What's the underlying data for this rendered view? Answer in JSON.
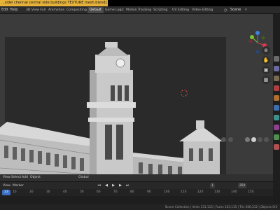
{
  "window": {
    "title": "...sidel chennai central side buildings TEXTURE mesh.blend]"
  },
  "menu": [
    "Edit",
    "Help"
  ],
  "workspace_tabs": [
    "3D View Full",
    "Animation",
    "Compositing",
    "Default",
    "Game Logic",
    "Motion Tracking",
    "Scripting",
    "UV Editing",
    "Video Editing"
  ],
  "active_tab_index": 3,
  "scene": {
    "label": "Scene"
  },
  "viewport_header": {
    "items": [
      "View",
      "Select",
      "Add",
      "Object"
    ],
    "mode": "Global"
  },
  "timeline": {
    "items": [
      "View",
      "Marker"
    ],
    "ruler_ticks": [
      "23",
      "10",
      "20",
      "30",
      "40",
      "50",
      "60",
      "70",
      "80",
      "90",
      "100",
      "110",
      "120",
      "130",
      "140",
      "150"
    ],
    "start_frame": "1",
    "end_frame": "250"
  },
  "status": {
    "text": "Scene Collection | Verts 131,115 | Faces 103,115 | Tris 206,312 | Objects 0/3"
  },
  "colors": {
    "title_highlight": "#e6b23a",
    "gizmo_x": "#e0394f",
    "gizmo_y": "#7ac230",
    "gizmo_z": "#3e7fe0",
    "playhead": "#3a6fc4"
  },
  "icons": {
    "cursor": "3d-cursor-icon",
    "zoom": "zoom-icon",
    "hand": "hand-icon",
    "camera": "camera-icon",
    "grid": "grid-icon"
  }
}
